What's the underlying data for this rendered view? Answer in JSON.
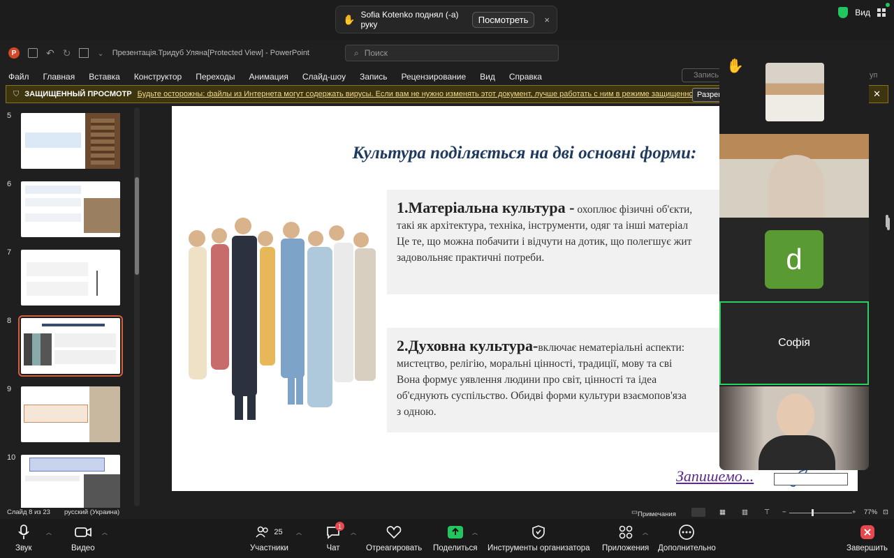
{
  "zoom_top": {
    "notice_icon": "raised-hand",
    "notice_text": "Sofia Kotenko поднял (-а) руку",
    "notice_button": "Посмотреть",
    "notice_close": "×",
    "view_label": "Вид"
  },
  "ppt": {
    "logo": "P",
    "window_title": "Презентація.Тридуб Уляна[Protected View]  -  PowerPoint",
    "search_placeholder": "Поиск",
    "menu": [
      "Файл",
      "Главная",
      "Вставка",
      "Конструктор",
      "Переходы",
      "Анимация",
      "Слайд-шоу",
      "Запись",
      "Рецензирование",
      "Вид",
      "Справка"
    ],
    "record_button": "Запись",
    "share_fragment": "уп",
    "protected_title": "ЗАЩИЩЕННЫЙ ПРОСМОТР",
    "protected_message": "Будьте осторожны: файлы из Интернета могут содержать вирусы. Если вам не нужно изменять этот документ, лучше работать с ним в режиме защищенного просмотра.",
    "allow_button": "Разрешить редактирование",
    "protected_close": "✕",
    "thumb_numbers": [
      "5",
      "6",
      "7",
      "8",
      "9",
      "10"
    ],
    "selected_slide": "8",
    "slide": {
      "title": "Культура поділяється на дві основні форми:",
      "box1_heading": "1.Матеріальна культура -",
      "box1_lines": [
        " охоплює фізичні об'єкти,",
        "такі як архітектура, техніка, інструменти, одяг та інші матеріал",
        "Це те, що можна побачити і відчути на дотик, що полегшує жит",
        "задовольняє практичні потреби."
      ],
      "box2_heading": "2.Духовна культура-",
      "box2_lines": [
        "включає нематеріальні аспекти: ",
        "мистецтво, релігію, моральні цінності, традиції, мову та сві",
        "Вона формує уявлення людини про світ, цінності та ідеа",
        "об'єднують суспільство. Обидві форми культури взаємопов'яза",
        "з одною."
      ],
      "write_text": "Запишемо..."
    },
    "status": {
      "slide_counter": "Слайд 8 из 23",
      "language": "русский (Украина)",
      "notes": "Примечания",
      "zoom": "77%"
    }
  },
  "video": {
    "tile_labels": {
      "d_initial": "d",
      "sofia": "Софія"
    },
    "hand_icon": "raised-hand"
  },
  "zoom_bar": {
    "audio": "Звук",
    "video": "Видео",
    "participants": "Участники",
    "participants_count": "25",
    "chat": "Чат",
    "chat_badge": "1",
    "react": "Отреагировать",
    "share": "Поделиться",
    "host_tools": "Инструменты организатора",
    "apps": "Приложения",
    "more": "Дополнительно",
    "end": "Завершить"
  },
  "colors": {
    "accent_green": "#22c55e",
    "protected_yellow": "#8a7418",
    "selection_orange": "#d2603f",
    "slide_title_blue": "#1e3a5f",
    "end_red": "#e5484d"
  }
}
